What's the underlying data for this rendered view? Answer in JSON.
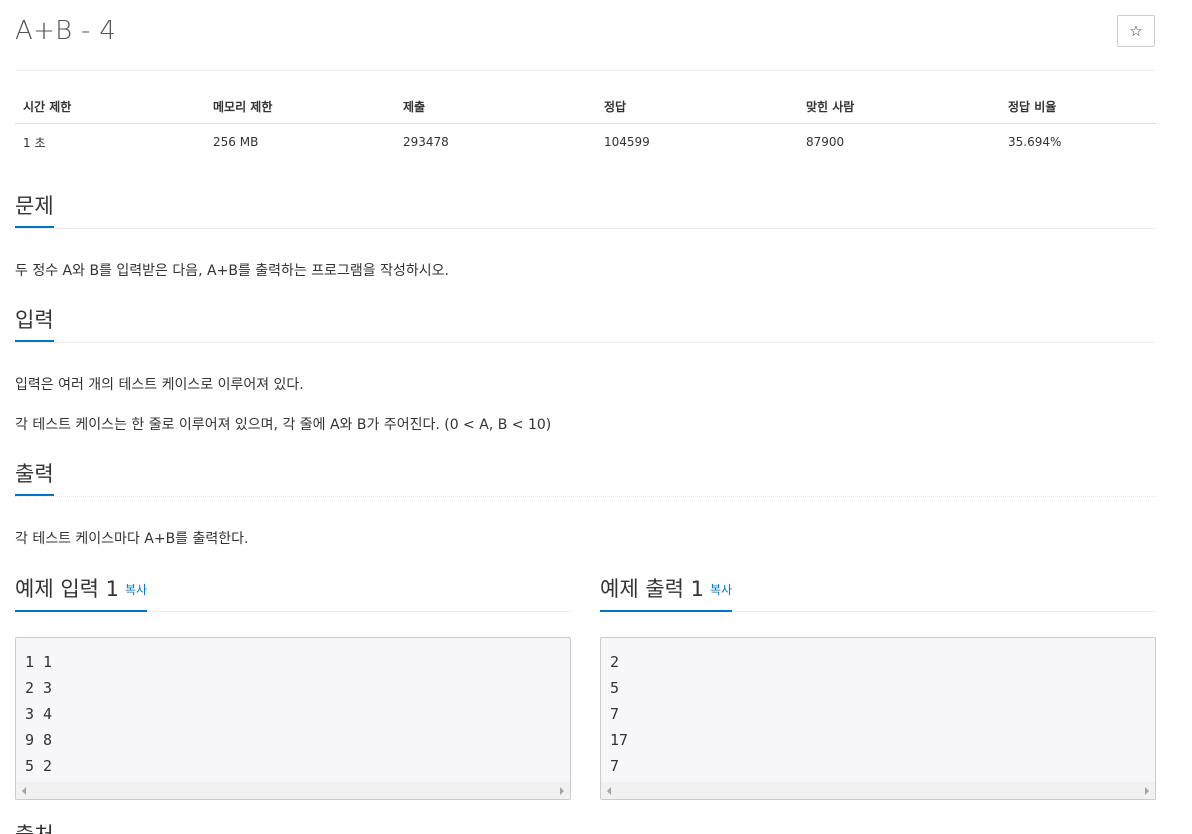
{
  "problem": {
    "title": "A+B - 4",
    "star_icon": "☆"
  },
  "info_table": {
    "headers": [
      "시간 제한",
      "메모리 제한",
      "제출",
      "정답",
      "맞힌 사람",
      "정답 비율"
    ],
    "values": [
      "1 초",
      "256 MB",
      "293478",
      "104599",
      "87900",
      "35.694%"
    ]
  },
  "sections": {
    "problem": {
      "title": "문제",
      "text": "두 정수 A와 B를 입력받은 다음, A+B를 출력하는 프로그램을 작성하시오."
    },
    "input": {
      "title": "입력",
      "lines": [
        "입력은 여러 개의 테스트 케이스로 이루어져 있다.",
        "각 테스트 케이스는 한 줄로 이루어져 있으며, 각 줄에 A와 B가 주어진다. (0 < A, B < 10)"
      ]
    },
    "output": {
      "title": "출력",
      "text": "각 테스트 케이스마다 A+B를 출력한다."
    }
  },
  "samples": {
    "input": {
      "title": "예제 입력 1",
      "copy_label": "복사",
      "content": "1 1\n2 3\n3 4\n9 8\n5 2"
    },
    "output": {
      "title": "예제 출력 1",
      "copy_label": "복사",
      "content": "2\n5\n7\n17\n7"
    }
  },
  "next_heading": "출처",
  "colors": {
    "accent": "#0076c0",
    "text": "#333333",
    "sample_bg": "#f7f7f9"
  }
}
